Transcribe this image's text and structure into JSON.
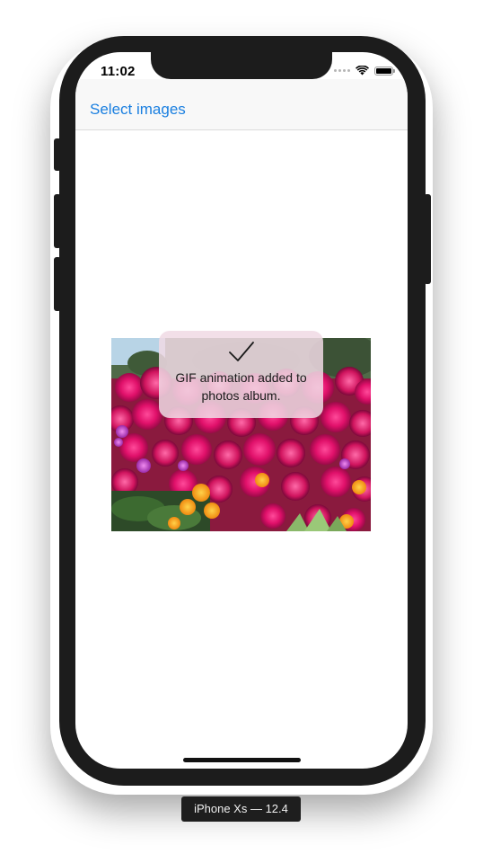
{
  "status_bar": {
    "time": "11:02",
    "icons": [
      "cellular-dots-icon",
      "wifi-icon",
      "battery-icon"
    ]
  },
  "navbar": {
    "left_button_label": "Select images",
    "accent_color": "#1a7fe0"
  },
  "content": {
    "image": "flower-field-photo"
  },
  "hud": {
    "icon": "checkmark-icon",
    "message": "GIF animation added to photos album."
  },
  "simulator": {
    "device_label": "iPhone Xs — 12.4"
  }
}
